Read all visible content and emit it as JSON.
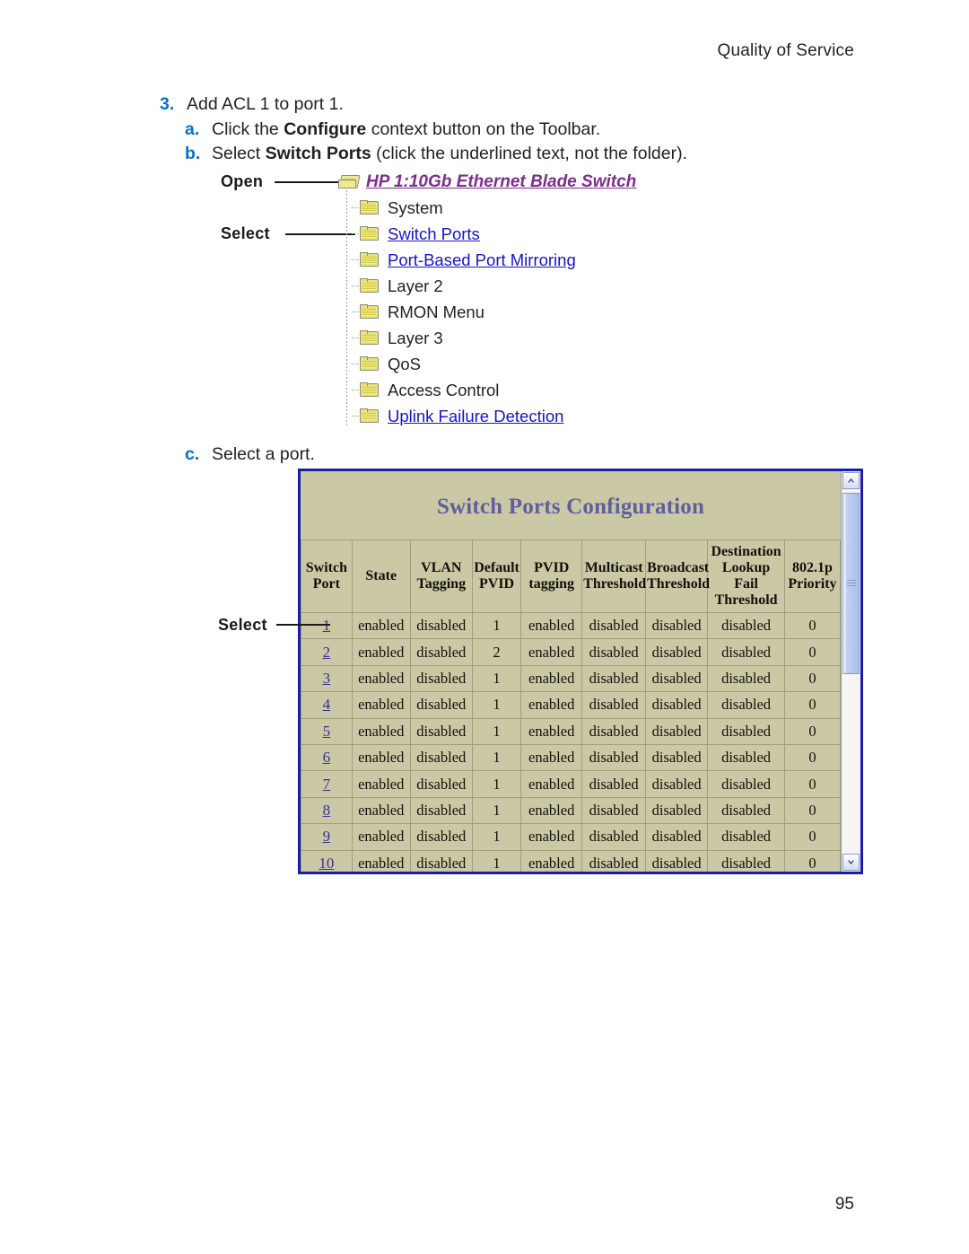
{
  "page": {
    "running_head": "Quality of Service",
    "folio": "95"
  },
  "steps": {
    "step3": {
      "marker": "3.",
      "text": "Add ACL 1 to port 1."
    },
    "step3a": {
      "marker": "a.",
      "pre": "Click the ",
      "bold": "Configure",
      "post": " context button on the Toolbar."
    },
    "step3b": {
      "marker": "b.",
      "pre": "Select ",
      "bold": "Switch Ports",
      "post": " (click the underlined text, not the folder)."
    },
    "step3c": {
      "marker": "c.",
      "text": "Select a port."
    }
  },
  "tree_figure": {
    "callouts": [
      {
        "label": "Open"
      },
      {
        "label": "Select"
      }
    ],
    "items": [
      {
        "label": "HP 1:10Gb Ethernet Blade Switch",
        "style": "root-link",
        "folder": "open-folder-icon"
      },
      {
        "label": "System",
        "style": "plain",
        "folder": "folder-icon"
      },
      {
        "label": "Switch Ports",
        "style": "link",
        "folder": "folder-icon"
      },
      {
        "label": "Port-Based Port Mirroring",
        "style": "link",
        "folder": "folder-icon"
      },
      {
        "label": "Layer 2",
        "style": "plain",
        "folder": "folder-icon"
      },
      {
        "label": "RMON Menu",
        "style": "plain",
        "folder": "folder-icon"
      },
      {
        "label": "Layer 3",
        "style": "plain",
        "folder": "folder-icon"
      },
      {
        "label": "QoS",
        "style": "plain",
        "folder": "folder-icon"
      },
      {
        "label": "Access Control",
        "style": "plain",
        "folder": "folder-icon"
      },
      {
        "label": "Uplink Failure Detection",
        "style": "link",
        "folder": "folder-icon"
      }
    ]
  },
  "switch_panel": {
    "title": "Switch Ports Configuration",
    "callout_label": "Select",
    "colors": {
      "panel_background": "#cbc9a5",
      "panel_border": "#1c1ca8",
      "title_text": "#5f5f9e",
      "link_text": "#3b2f8f",
      "cell_border": "#a09d7d"
    },
    "columns": [
      "Switch Port",
      "State",
      "VLAN Tagging",
      "Default PVID",
      "PVID tagging",
      "Multicast Threshold",
      "Broadcast Threshold",
      "Destination Lookup Fail Threshold",
      "802.1p Priority"
    ],
    "rows": [
      {
        "port": "1",
        "state": "enabled",
        "vlan_tagging": "disabled",
        "default_pvid": "1",
        "pvid_tagging": "enabled",
        "multicast_threshold": "disabled",
        "broadcast_threshold": "disabled",
        "dlf_threshold": "disabled",
        "priority": "0"
      },
      {
        "port": "2",
        "state": "enabled",
        "vlan_tagging": "disabled",
        "default_pvid": "2",
        "pvid_tagging": "enabled",
        "multicast_threshold": "disabled",
        "broadcast_threshold": "disabled",
        "dlf_threshold": "disabled",
        "priority": "0"
      },
      {
        "port": "3",
        "state": "enabled",
        "vlan_tagging": "disabled",
        "default_pvid": "1",
        "pvid_tagging": "enabled",
        "multicast_threshold": "disabled",
        "broadcast_threshold": "disabled",
        "dlf_threshold": "disabled",
        "priority": "0"
      },
      {
        "port": "4",
        "state": "enabled",
        "vlan_tagging": "disabled",
        "default_pvid": "1",
        "pvid_tagging": "enabled",
        "multicast_threshold": "disabled",
        "broadcast_threshold": "disabled",
        "dlf_threshold": "disabled",
        "priority": "0"
      },
      {
        "port": "5",
        "state": "enabled",
        "vlan_tagging": "disabled",
        "default_pvid": "1",
        "pvid_tagging": "enabled",
        "multicast_threshold": "disabled",
        "broadcast_threshold": "disabled",
        "dlf_threshold": "disabled",
        "priority": "0"
      },
      {
        "port": "6",
        "state": "enabled",
        "vlan_tagging": "disabled",
        "default_pvid": "1",
        "pvid_tagging": "enabled",
        "multicast_threshold": "disabled",
        "broadcast_threshold": "disabled",
        "dlf_threshold": "disabled",
        "priority": "0"
      },
      {
        "port": "7",
        "state": "enabled",
        "vlan_tagging": "disabled",
        "default_pvid": "1",
        "pvid_tagging": "enabled",
        "multicast_threshold": "disabled",
        "broadcast_threshold": "disabled",
        "dlf_threshold": "disabled",
        "priority": "0"
      },
      {
        "port": "8",
        "state": "enabled",
        "vlan_tagging": "disabled",
        "default_pvid": "1",
        "pvid_tagging": "enabled",
        "multicast_threshold": "disabled",
        "broadcast_threshold": "disabled",
        "dlf_threshold": "disabled",
        "priority": "0"
      },
      {
        "port": "9",
        "state": "enabled",
        "vlan_tagging": "disabled",
        "default_pvid": "1",
        "pvid_tagging": "enabled",
        "multicast_threshold": "disabled",
        "broadcast_threshold": "disabled",
        "dlf_threshold": "disabled",
        "priority": "0"
      },
      {
        "port": "10",
        "state": "enabled",
        "vlan_tagging": "disabled",
        "default_pvid": "1",
        "pvid_tagging": "enabled",
        "multicast_threshold": "disabled",
        "broadcast_threshold": "disabled",
        "dlf_threshold": "disabled",
        "priority": "0"
      }
    ]
  }
}
